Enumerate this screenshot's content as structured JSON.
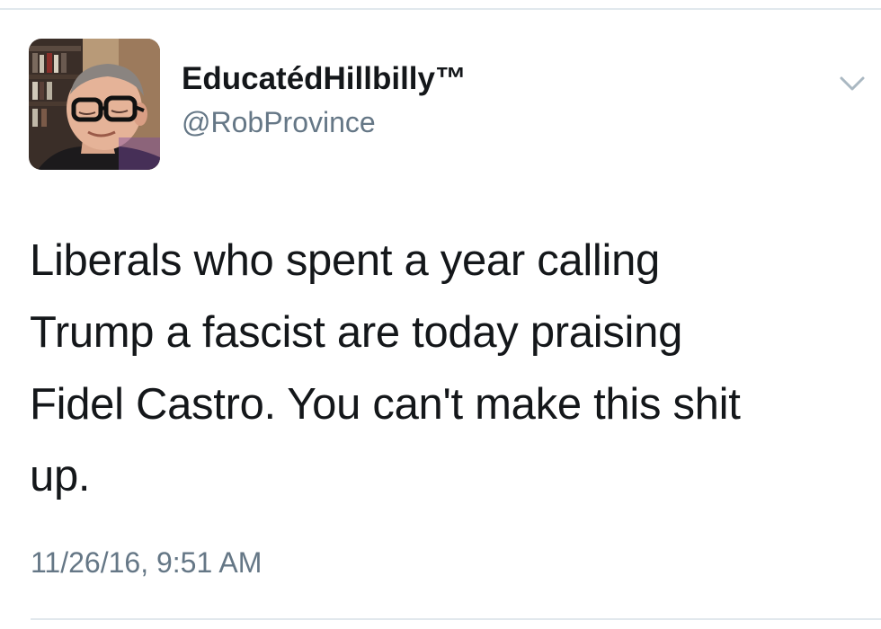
{
  "author": {
    "display_name": "EducatédHillbilly™",
    "handle": "@RobProvince",
    "avatar_icon": "profile-photo"
  },
  "tweet": {
    "text_lines": [
      "Liberals who spent a year calling",
      "Trump a fascist are today praising",
      "Fidel Castro. You can't make this shit",
      "up."
    ],
    "timestamp": "11/26/16, 9:51 AM"
  },
  "menu": {
    "icon": "chevron-down-icon"
  },
  "colors": {
    "text_primary": "#14171a",
    "text_secondary": "#657786",
    "divider": "#e1e8ed",
    "caret": "#aab8c2"
  }
}
